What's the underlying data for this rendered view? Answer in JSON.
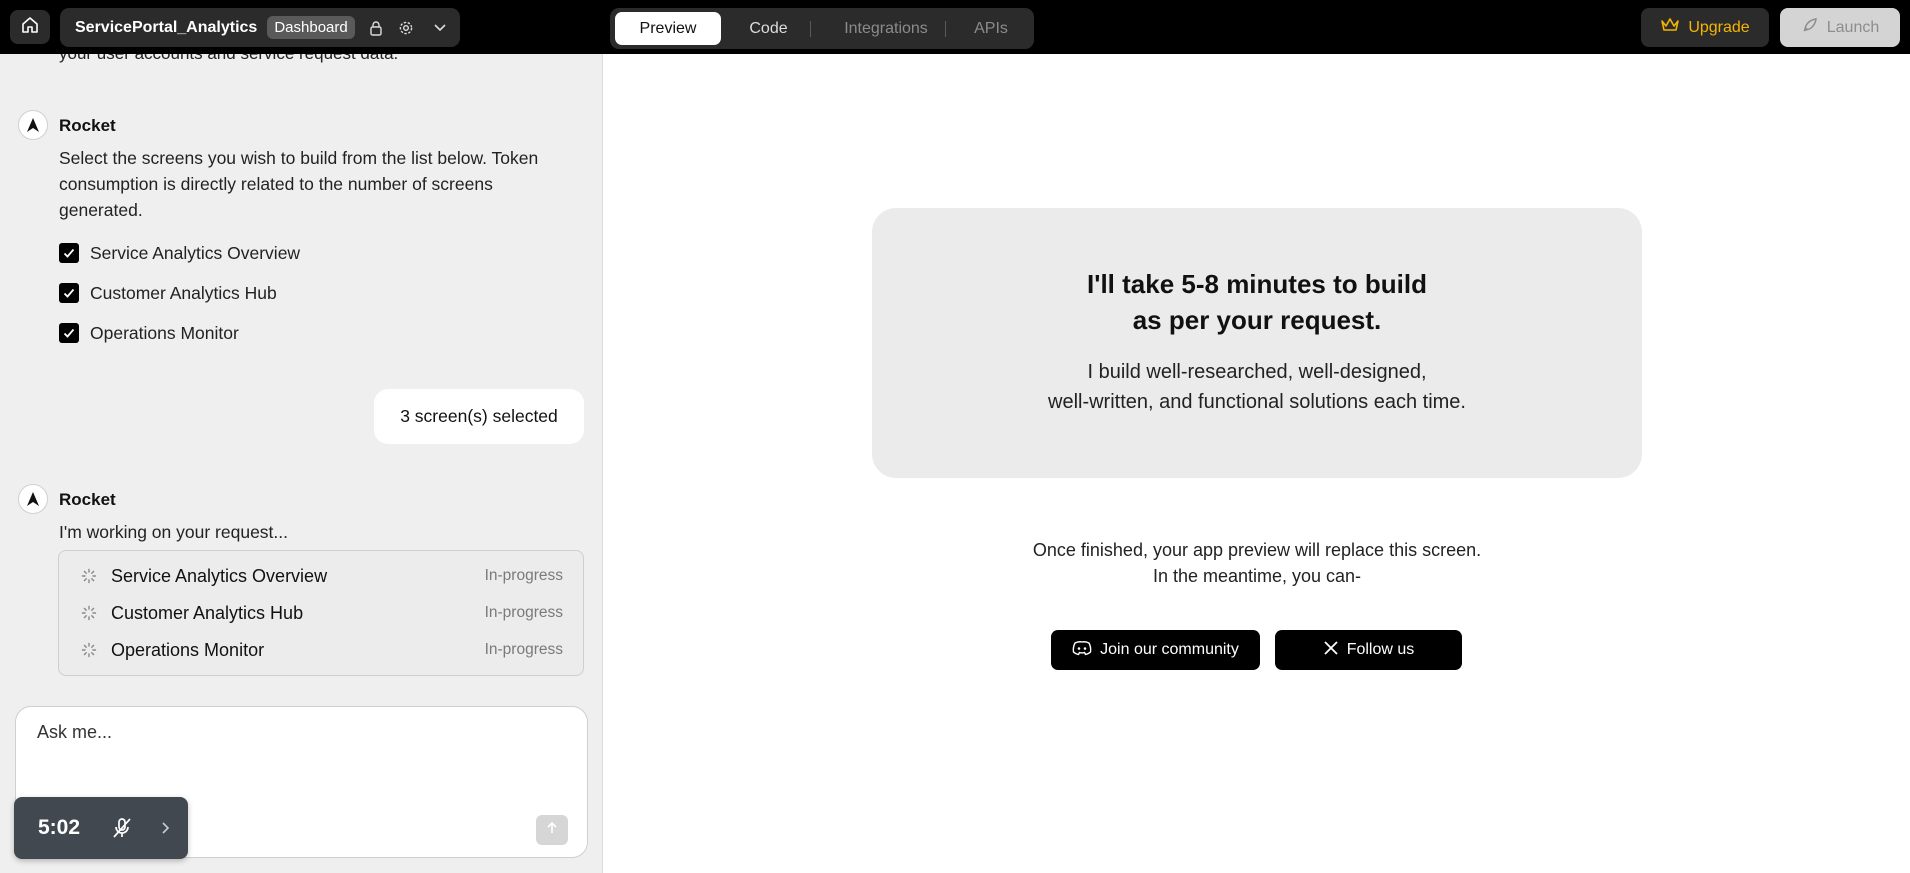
{
  "topbar": {
    "project_name": "ServicePortal_Analytics",
    "project_badge": "Dashboard",
    "tabs": [
      {
        "label": "Preview",
        "state": "active"
      },
      {
        "label": "Code",
        "state": "normal"
      },
      {
        "label": "Integrations",
        "state": "disabled"
      },
      {
        "label": "APIs",
        "state": "disabled"
      }
    ],
    "upgrade_label": "Upgrade",
    "launch_label": "Launch"
  },
  "chat": {
    "cut_off_text": "your user accounts and service request data.",
    "message1": {
      "sender": "Rocket",
      "text": "Select the screens you wish to build from the list below. Token consumption is directly related to the number of screens generated.",
      "options": [
        {
          "label": "Service Analytics Overview",
          "checked": true
        },
        {
          "label": "Customer Analytics Hub",
          "checked": true
        },
        {
          "label": "Operations Monitor",
          "checked": true
        }
      ]
    },
    "user_reply": "3 screen(s) selected",
    "message2": {
      "sender": "Rocket",
      "text": "I'm working on your request...",
      "progress": [
        {
          "label": "Service Analytics Overview",
          "status": "In-progress"
        },
        {
          "label": "Customer Analytics Hub",
          "status": "In-progress"
        },
        {
          "label": "Operations Monitor",
          "status": "In-progress"
        }
      ]
    }
  },
  "input": {
    "placeholder": "Ask me..."
  },
  "timer": {
    "value": "5:02"
  },
  "preview": {
    "title_line1": "I'll take 5-8 minutes to build",
    "title_line2": "as per your request.",
    "desc_line1": "I build well-researched, well-designed,",
    "desc_line2": "well-written, and functional solutions each time.",
    "finish_line1": "Once finished, your app preview will replace this screen.",
    "finish_line2": "In the meantime, you can-",
    "community_label": "Join our community",
    "follow_label": "Follow us"
  },
  "colors": {
    "topbar_bg": "#000000",
    "accent_upgrade": "#f4b400",
    "panel_bg": "#efefef",
    "card_bg": "#ebebeb"
  }
}
